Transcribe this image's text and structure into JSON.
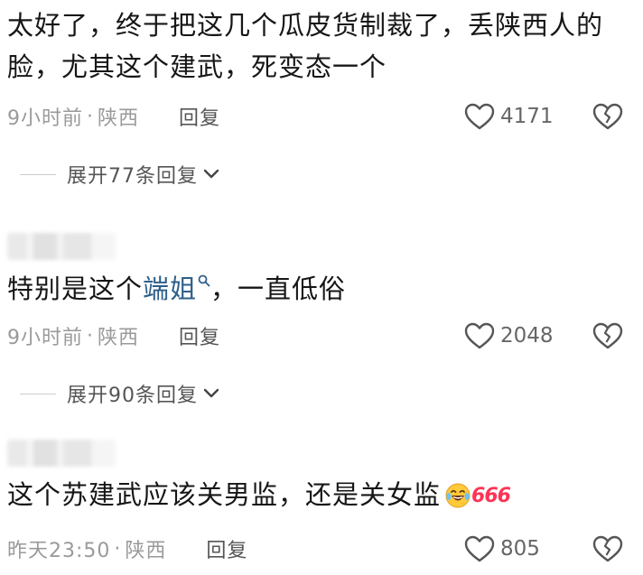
{
  "comments": [
    {
      "text": "太好了，终于把这几个瓜皮货制裁了，丢陕西人的脸，尤其这个建武，死变态一个",
      "time": "9小时前",
      "location": "陕西",
      "reply_label": "回复",
      "likes": "4171",
      "expand_label": "展开77条回复"
    },
    {
      "text_before": "特别是这个",
      "mention": "端姐",
      "text_after": "，一直低俗",
      "time": "9小时前",
      "location": "陕西",
      "reply_label": "回复",
      "likes": "2048",
      "expand_label": "展开90条回复"
    },
    {
      "text": "这个苏建武应该关男监，还是关女监",
      "badge": "666",
      "time": "昨天23:50",
      "location": "陕西",
      "reply_label": "回复",
      "likes": "805"
    }
  ],
  "separator": "·",
  "colors": {
    "mention": "#2d5f8a",
    "meta": "#9a9a9a",
    "badge": "#ff3355"
  }
}
